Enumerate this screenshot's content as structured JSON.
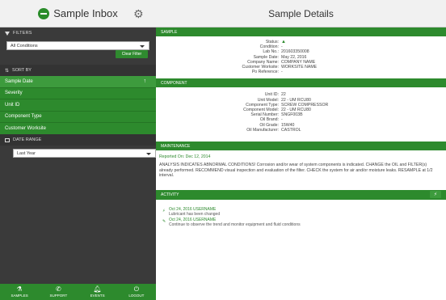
{
  "left": {
    "title": "Sample Inbox",
    "filters": {
      "label": "FILTERS",
      "conditions_value": "All Conditions",
      "clear_label": "Clear Filter"
    },
    "sort": {
      "label": "SORT BY",
      "items": [
        "Sample Date",
        "Severity",
        "Unit ID",
        "Component Type",
        "Customer Worksite"
      ]
    },
    "date_range": {
      "label": "DATE RANGE",
      "value": "Last Year"
    },
    "nav": [
      "SAMPLES",
      "SUPPORT",
      "EVENTS",
      "LOGOUT"
    ]
  },
  "right": {
    "title": "Sample Details",
    "sample": {
      "section": "SAMPLE",
      "rows": [
        {
          "k": "Status:",
          "v": "▲"
        },
        {
          "k": "Condition:",
          "v": "-"
        },
        {
          "k": "Lab No.:",
          "v": "201603350008"
        },
        {
          "k": "Sample Date:",
          "v": "May 22, 2016"
        },
        {
          "k": "Company Name:",
          "v": "COMPANY NAME"
        },
        {
          "k": "Customer Worksite:",
          "v": "WORKSITE NAME"
        },
        {
          "k": "Po Reference:",
          "v": "-"
        }
      ]
    },
    "component": {
      "section": "COMPONENT",
      "rows": [
        {
          "k": "Unit ID:",
          "v": "22"
        },
        {
          "k": "Unit Model:",
          "v": "22 - UM RCU80"
        },
        {
          "k": "Component Type:",
          "v": "SCREW COMPRESSOR"
        },
        {
          "k": "Component Model:",
          "v": "22 - UM RCU80"
        },
        {
          "k": "Serial Number:",
          "v": "SNGF003B"
        },
        {
          "k": "Oil Brand:",
          "v": "-"
        },
        {
          "k": "Oil Grade:",
          "v": "15W40"
        },
        {
          "k": "Oil Manufacturer:",
          "v": "CASTROL"
        }
      ]
    },
    "maintenance": {
      "section": "MAINTENANCE",
      "reported_on": "Reported On: Dec 12, 2014",
      "line1": "ANALYSIS INDICATES ABNORMAL CONDITIONS! Corrosion and/or wear of system components is indicated. CHANGE the OIL and FILTER(s)",
      "line2": "already performed. RECOMMEND visual inspection and evaluation of the filter. CHECK the system for air and/or moisture leaks. RESAMPLE at 1/2",
      "line3": "interval."
    },
    "activity": {
      "section": "ACTIVITY",
      "button": "⚡",
      "entries": [
        {
          "meta": "Oct 24, 2016   USERNAME",
          "text": "Lubricant has been changed"
        },
        {
          "meta": "Oct 24, 2016   USERNAME",
          "text": "Continue to observe the trend and monitor equipment and fluid conditions"
        }
      ]
    }
  }
}
